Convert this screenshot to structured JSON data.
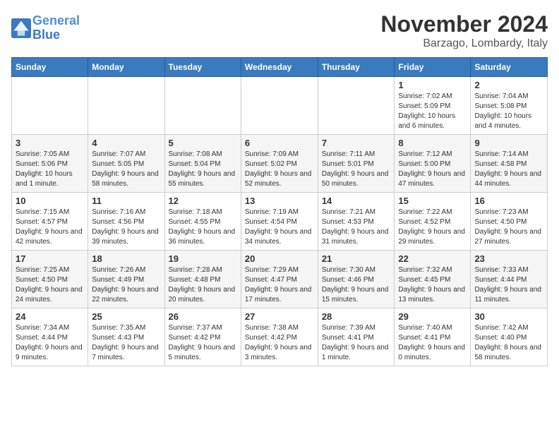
{
  "logo": {
    "line1": "General",
    "line2": "Blue"
  },
  "title": "November 2024",
  "location": "Barzago, Lombardy, Italy",
  "headers": [
    "Sunday",
    "Monday",
    "Tuesday",
    "Wednesday",
    "Thursday",
    "Friday",
    "Saturday"
  ],
  "weeks": [
    [
      {
        "day": "",
        "info": ""
      },
      {
        "day": "",
        "info": ""
      },
      {
        "day": "",
        "info": ""
      },
      {
        "day": "",
        "info": ""
      },
      {
        "day": "",
        "info": ""
      },
      {
        "day": "1",
        "info": "Sunrise: 7:02 AM\nSunset: 5:09 PM\nDaylight: 10 hours and 6 minutes."
      },
      {
        "day": "2",
        "info": "Sunrise: 7:04 AM\nSunset: 5:08 PM\nDaylight: 10 hours and 4 minutes."
      }
    ],
    [
      {
        "day": "3",
        "info": "Sunrise: 7:05 AM\nSunset: 5:06 PM\nDaylight: 10 hours and 1 minute."
      },
      {
        "day": "4",
        "info": "Sunrise: 7:07 AM\nSunset: 5:05 PM\nDaylight: 9 hours and 58 minutes."
      },
      {
        "day": "5",
        "info": "Sunrise: 7:08 AM\nSunset: 5:04 PM\nDaylight: 9 hours and 55 minutes."
      },
      {
        "day": "6",
        "info": "Sunrise: 7:09 AM\nSunset: 5:02 PM\nDaylight: 9 hours and 52 minutes."
      },
      {
        "day": "7",
        "info": "Sunrise: 7:11 AM\nSunset: 5:01 PM\nDaylight: 9 hours and 50 minutes."
      },
      {
        "day": "8",
        "info": "Sunrise: 7:12 AM\nSunset: 5:00 PM\nDaylight: 9 hours and 47 minutes."
      },
      {
        "day": "9",
        "info": "Sunrise: 7:14 AM\nSunset: 4:58 PM\nDaylight: 9 hours and 44 minutes."
      }
    ],
    [
      {
        "day": "10",
        "info": "Sunrise: 7:15 AM\nSunset: 4:57 PM\nDaylight: 9 hours and 42 minutes."
      },
      {
        "day": "11",
        "info": "Sunrise: 7:16 AM\nSunset: 4:56 PM\nDaylight: 9 hours and 39 minutes."
      },
      {
        "day": "12",
        "info": "Sunrise: 7:18 AM\nSunset: 4:55 PM\nDaylight: 9 hours and 36 minutes."
      },
      {
        "day": "13",
        "info": "Sunrise: 7:19 AM\nSunset: 4:54 PM\nDaylight: 9 hours and 34 minutes."
      },
      {
        "day": "14",
        "info": "Sunrise: 7:21 AM\nSunset: 4:53 PM\nDaylight: 9 hours and 31 minutes."
      },
      {
        "day": "15",
        "info": "Sunrise: 7:22 AM\nSunset: 4:52 PM\nDaylight: 9 hours and 29 minutes."
      },
      {
        "day": "16",
        "info": "Sunrise: 7:23 AM\nSunset: 4:50 PM\nDaylight: 9 hours and 27 minutes."
      }
    ],
    [
      {
        "day": "17",
        "info": "Sunrise: 7:25 AM\nSunset: 4:50 PM\nDaylight: 9 hours and 24 minutes."
      },
      {
        "day": "18",
        "info": "Sunrise: 7:26 AM\nSunset: 4:49 PM\nDaylight: 9 hours and 22 minutes."
      },
      {
        "day": "19",
        "info": "Sunrise: 7:28 AM\nSunset: 4:48 PM\nDaylight: 9 hours and 20 minutes."
      },
      {
        "day": "20",
        "info": "Sunrise: 7:29 AM\nSunset: 4:47 PM\nDaylight: 9 hours and 17 minutes."
      },
      {
        "day": "21",
        "info": "Sunrise: 7:30 AM\nSunset: 4:46 PM\nDaylight: 9 hours and 15 minutes."
      },
      {
        "day": "22",
        "info": "Sunrise: 7:32 AM\nSunset: 4:45 PM\nDaylight: 9 hours and 13 minutes."
      },
      {
        "day": "23",
        "info": "Sunrise: 7:33 AM\nSunset: 4:44 PM\nDaylight: 9 hours and 11 minutes."
      }
    ],
    [
      {
        "day": "24",
        "info": "Sunrise: 7:34 AM\nSunset: 4:44 PM\nDaylight: 9 hours and 9 minutes."
      },
      {
        "day": "25",
        "info": "Sunrise: 7:35 AM\nSunset: 4:43 PM\nDaylight: 9 hours and 7 minutes."
      },
      {
        "day": "26",
        "info": "Sunrise: 7:37 AM\nSunset: 4:42 PM\nDaylight: 9 hours and 5 minutes."
      },
      {
        "day": "27",
        "info": "Sunrise: 7:38 AM\nSunset: 4:42 PM\nDaylight: 9 hours and 3 minutes."
      },
      {
        "day": "28",
        "info": "Sunrise: 7:39 AM\nSunset: 4:41 PM\nDaylight: 9 hours and 1 minute."
      },
      {
        "day": "29",
        "info": "Sunrise: 7:40 AM\nSunset: 4:41 PM\nDaylight: 9 hours and 0 minutes."
      },
      {
        "day": "30",
        "info": "Sunrise: 7:42 AM\nSunset: 4:40 PM\nDaylight: 8 hours and 58 minutes."
      }
    ]
  ]
}
